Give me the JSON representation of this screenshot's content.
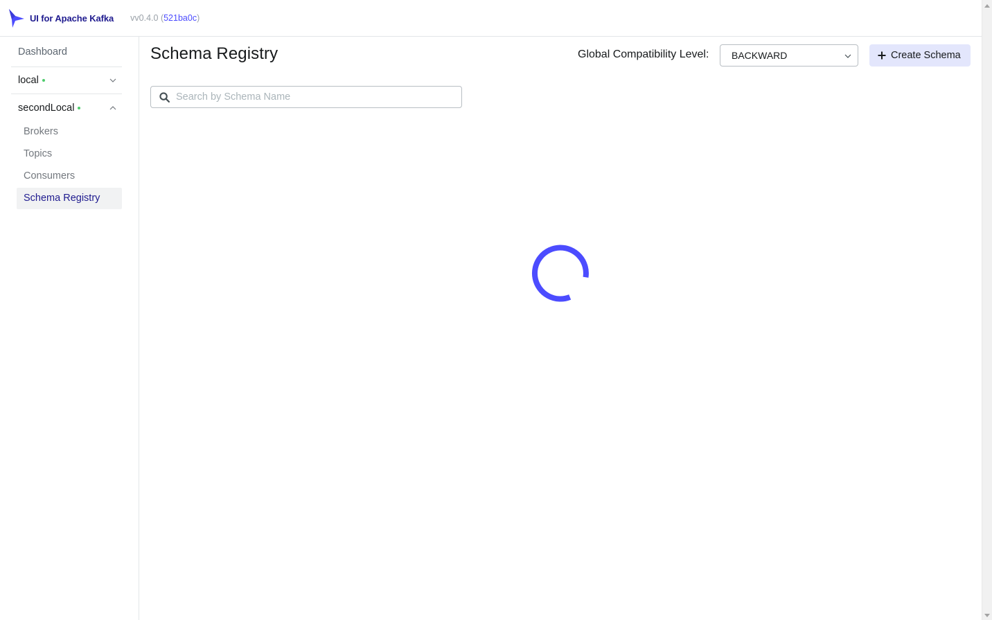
{
  "header": {
    "brand_title": "UI for Apache Kafka",
    "version_prefix": "v",
    "version": "v0.4.0",
    "version_open": " (",
    "commit": "521ba0c",
    "version_close": ")"
  },
  "sidebar": {
    "dashboard_label": "Dashboard",
    "clusters": [
      {
        "name": "local",
        "status": "online",
        "expanded": false
      },
      {
        "name": "secondLocal",
        "status": "online",
        "expanded": true
      }
    ],
    "menu": [
      {
        "label": "Brokers",
        "active": false
      },
      {
        "label": "Topics",
        "active": false
      },
      {
        "label": "Consumers",
        "active": false
      },
      {
        "label": "Schema Registry",
        "active": true
      }
    ]
  },
  "main": {
    "title": "Schema Registry",
    "compatibility_label": "Global Compatibility Level:",
    "compatibility_value": "BACKWARD",
    "create_button_label": "Create Schema",
    "search_placeholder": "Search by Schema Name",
    "search_value": "",
    "loading": true
  },
  "colors": {
    "brand": "#1f1b8f",
    "accent": "#4c4cff",
    "spinner": "#4c4cff",
    "status_online": "#4fcc6e",
    "button_bg": "#e3e6fc",
    "active_item_bg": "#f1f2f3"
  },
  "icons": {
    "logo": "kafka-ui-logo-icon",
    "search": "search-icon",
    "plus": "plus-icon",
    "chevron": "chevron-icon",
    "spinner": "loading-spinner"
  }
}
